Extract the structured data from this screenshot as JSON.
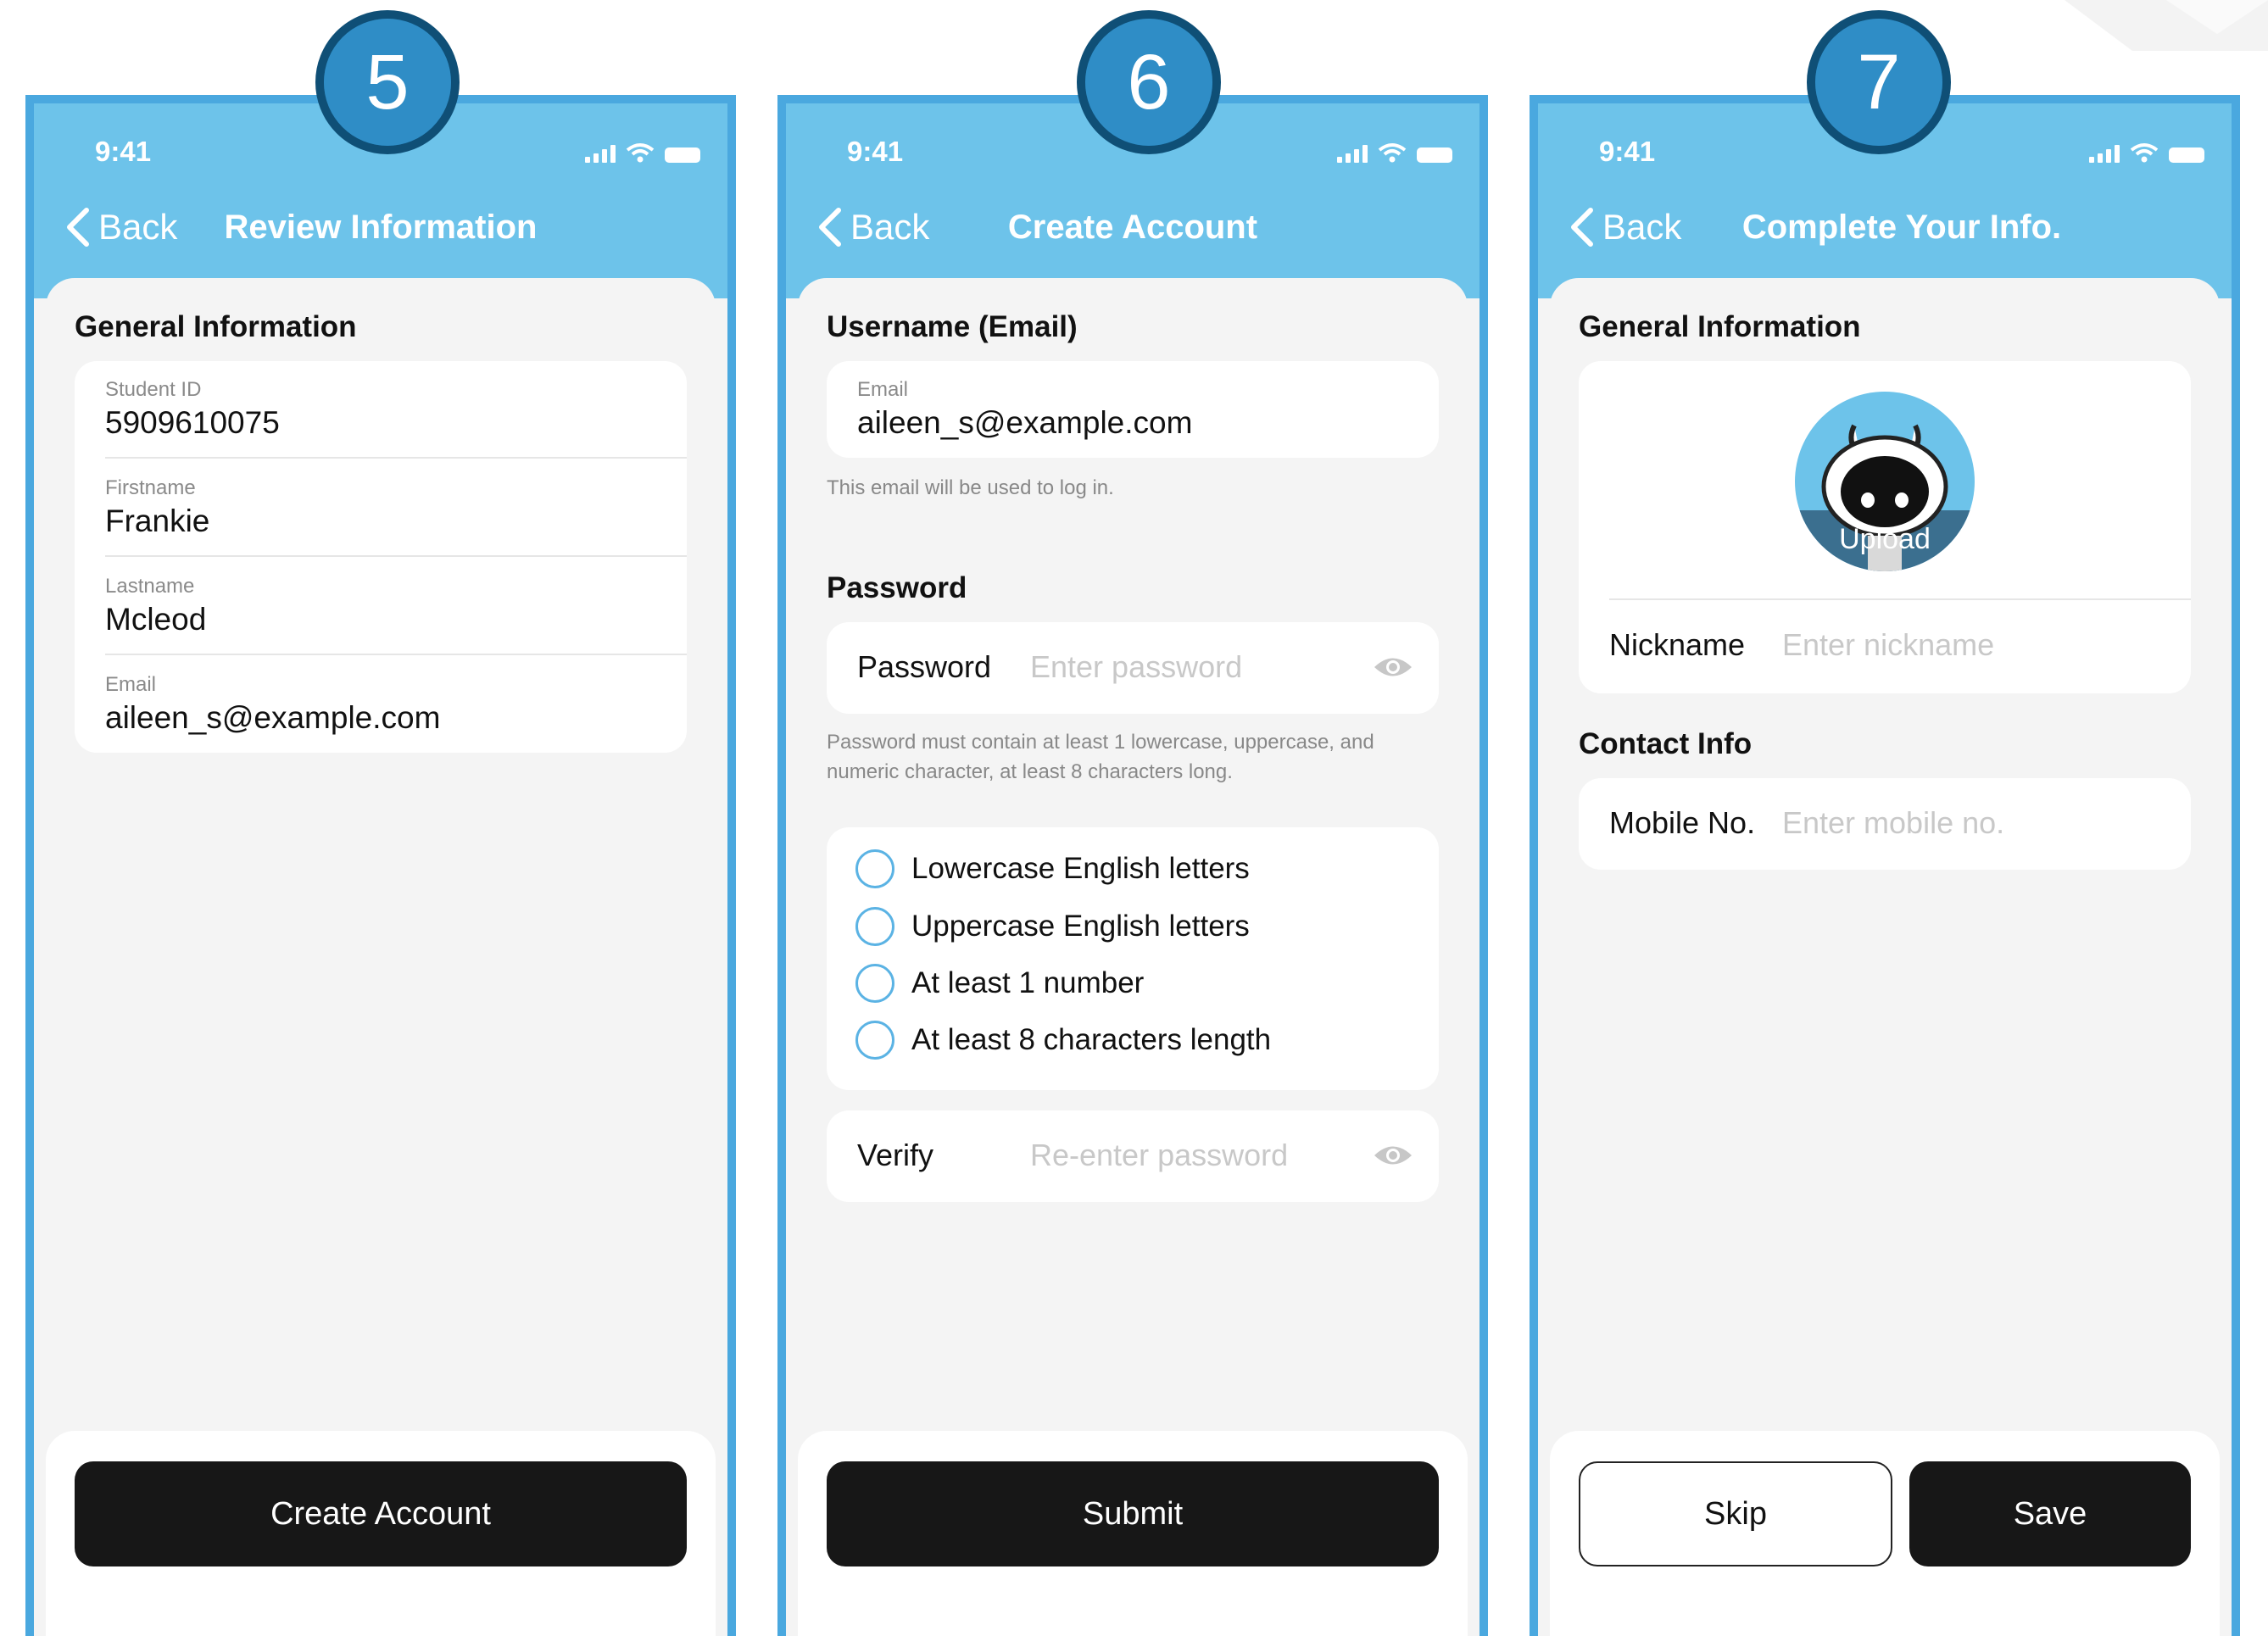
{
  "status_time": "9:41",
  "back_label": "Back",
  "screens": {
    "s5": {
      "step": "5",
      "title": "Review Information",
      "section": "General Information",
      "fields": [
        {
          "label": "Student ID",
          "value": "5909610075"
        },
        {
          "label": "Firstname",
          "value": "Frankie"
        },
        {
          "label": "Lastname",
          "value": "Mcleod"
        },
        {
          "label": "Email",
          "value": "aileen_s@example.com"
        }
      ],
      "button": "Create Account"
    },
    "s6": {
      "step": "6",
      "title": "Create Account",
      "username_section": "Username (Email)",
      "email_label": "Email",
      "email_value": "aileen_s@example.com",
      "email_helper": "This email will be used to log in.",
      "password_section": "Password",
      "password_label": "Password",
      "password_placeholder": "Enter password",
      "password_helper_1": "Password must contain at least 1 lowercase, uppercase, and",
      "password_helper_2": "numeric character, at least 8 characters long.",
      "requirements": [
        "Lowercase English letters",
        "Uppercase English letters",
        "At least 1 number",
        "At least 8 characters length"
      ],
      "verify_label": "Verify",
      "verify_placeholder": "Re-enter password",
      "button": "Submit"
    },
    "s7": {
      "step": "7",
      "title": "Complete Your Info.",
      "section": "General Information",
      "upload_label": "Upload",
      "nickname_label": "Nickname",
      "nickname_placeholder": "Enter nickname",
      "contact_section": "Contact Info",
      "mobile_label": "Mobile No.",
      "mobile_placeholder": "Enter mobile no.",
      "skip_button": "Skip",
      "save_button": "Save"
    }
  },
  "colors": {
    "header": "#6dc3ea",
    "frame": "#4aa8df",
    "badge": "#2f8dc6",
    "badge_border": "#0f4f76",
    "button_dark": "#171717"
  }
}
